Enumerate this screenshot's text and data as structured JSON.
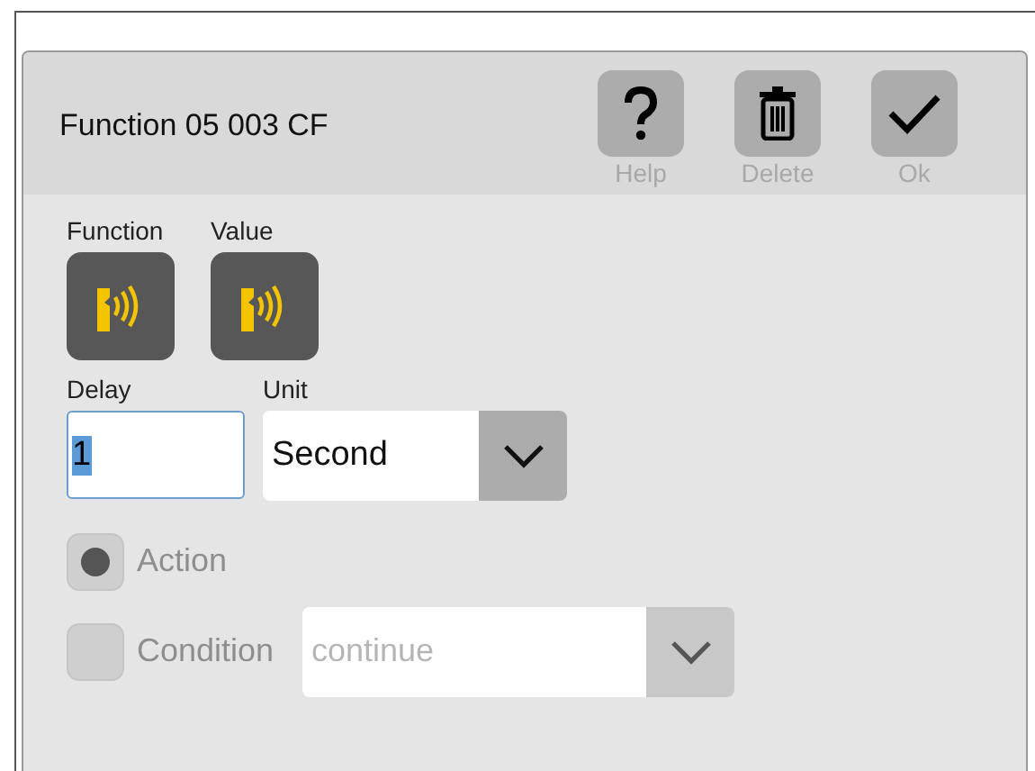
{
  "dialog": {
    "title": "Function 05 003 CF",
    "toolbar": [
      {
        "kind": "help",
        "label": "Help",
        "disabled": false
      },
      {
        "kind": "delete",
        "label": "Delete",
        "disabled": false
      },
      {
        "kind": "ok",
        "label": "Ok",
        "disabled": false
      }
    ]
  },
  "function": {
    "label": "Function"
  },
  "value": {
    "label": "Value"
  },
  "delay": {
    "label": "Delay",
    "value": "1"
  },
  "unit": {
    "label": "Unit",
    "value": "Second",
    "disabled": false
  },
  "options": [
    {
      "label": "Action",
      "selected": true,
      "disabled": true
    },
    {
      "label": "Condition",
      "selected": false,
      "disabled": true,
      "select": {
        "value": "continue",
        "disabled": true
      }
    }
  ]
}
